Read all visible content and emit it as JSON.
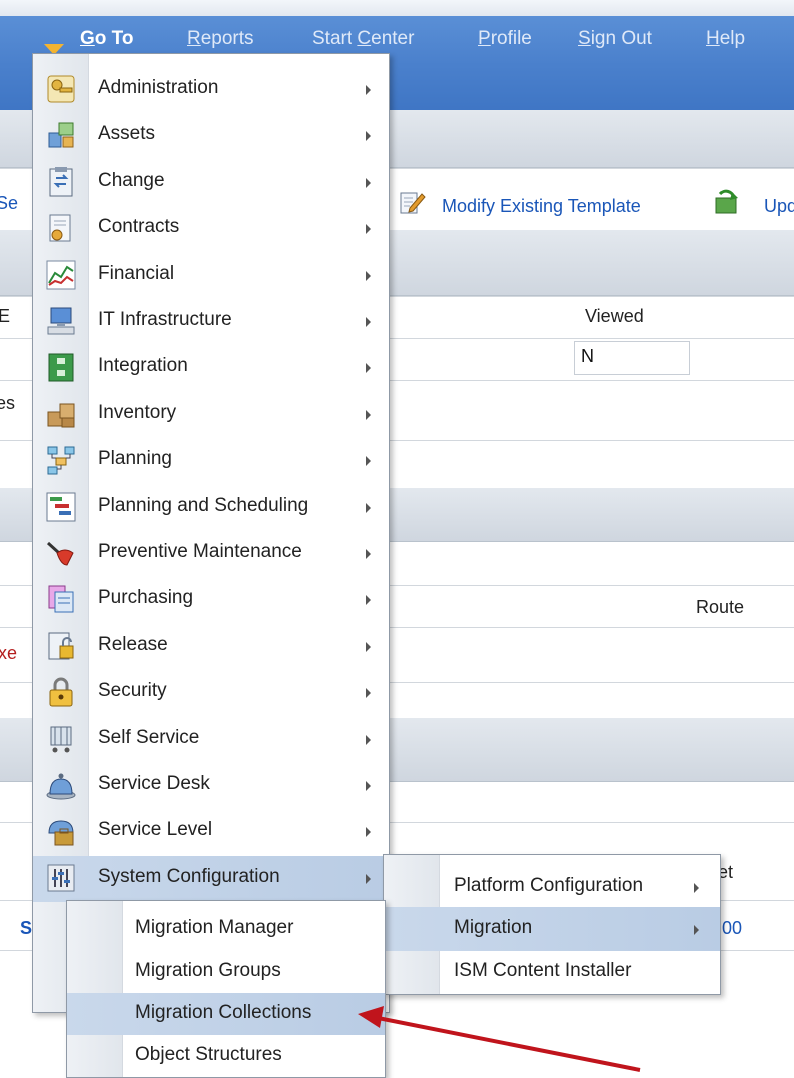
{
  "nav": {
    "goto": "Go To",
    "goto_u": "G",
    "goto_rest": "o To",
    "reports_u": "R",
    "reports_rest": "eports",
    "start_a": "Start ",
    "start_u": "C",
    "start_b": "enter",
    "profile_u": "P",
    "profile_rest": "rofile",
    "signout_u": "S",
    "signout_rest": "ign Out",
    "help_u": "H",
    "help_rest": "elp"
  },
  "background": {
    "se_fragment": "Se",
    "modify_template": "Modify Existing Template",
    "upd_fragment": "Upd",
    "e_fragment": "E",
    "viewed_header": "Viewed",
    "viewed_value": "N",
    "es_fragment": "es",
    "route_header": "Route",
    "xe_fragment": "xe",
    "et_fragment": "et",
    "s_fragment": "S",
    "num_fragment": "00"
  },
  "menu": {
    "items": [
      {
        "label": "Administration",
        "icon": "keys-icon"
      },
      {
        "label": "Assets",
        "icon": "assets-icon"
      },
      {
        "label": "Change",
        "icon": "change-icon"
      },
      {
        "label": "Contracts",
        "icon": "contract-icon"
      },
      {
        "label": "Financial",
        "icon": "chart-icon"
      },
      {
        "label": "IT Infrastructure",
        "icon": "computer-icon"
      },
      {
        "label": "Integration",
        "icon": "integration-icon"
      },
      {
        "label": "Inventory",
        "icon": "boxes-icon"
      },
      {
        "label": "Planning",
        "icon": "planning-icon"
      },
      {
        "label": "Planning and Scheduling",
        "icon": "gantt-icon"
      },
      {
        "label": "Preventive Maintenance",
        "icon": "oilcan-icon"
      },
      {
        "label": "Purchasing",
        "icon": "purchasing-icon"
      },
      {
        "label": "Release",
        "icon": "release-icon"
      },
      {
        "label": "Security",
        "icon": "lock-icon"
      },
      {
        "label": "Self Service",
        "icon": "cart-icon"
      },
      {
        "label": "Service Desk",
        "icon": "bell-icon"
      },
      {
        "label": "Service Level",
        "icon": "service-level-icon"
      },
      {
        "label": "System Configuration",
        "icon": "sliders-icon"
      }
    ],
    "highlighted": "System Configuration"
  },
  "submenu_system_configuration": {
    "items": [
      "Platform Configuration",
      "Migration",
      "ISM Content Installer"
    ],
    "highlighted": "Migration"
  },
  "submenu_migration": {
    "items": [
      "Migration Manager",
      "Migration Groups",
      "Migration Collections",
      "Object Structures"
    ],
    "highlighted": "Migration Collections"
  },
  "colors": {
    "nav_blue": "#4a80cc",
    "highlight": "#c0d1e8",
    "annotation_arrow": "#c0141c",
    "link": "#1a56b8"
  }
}
